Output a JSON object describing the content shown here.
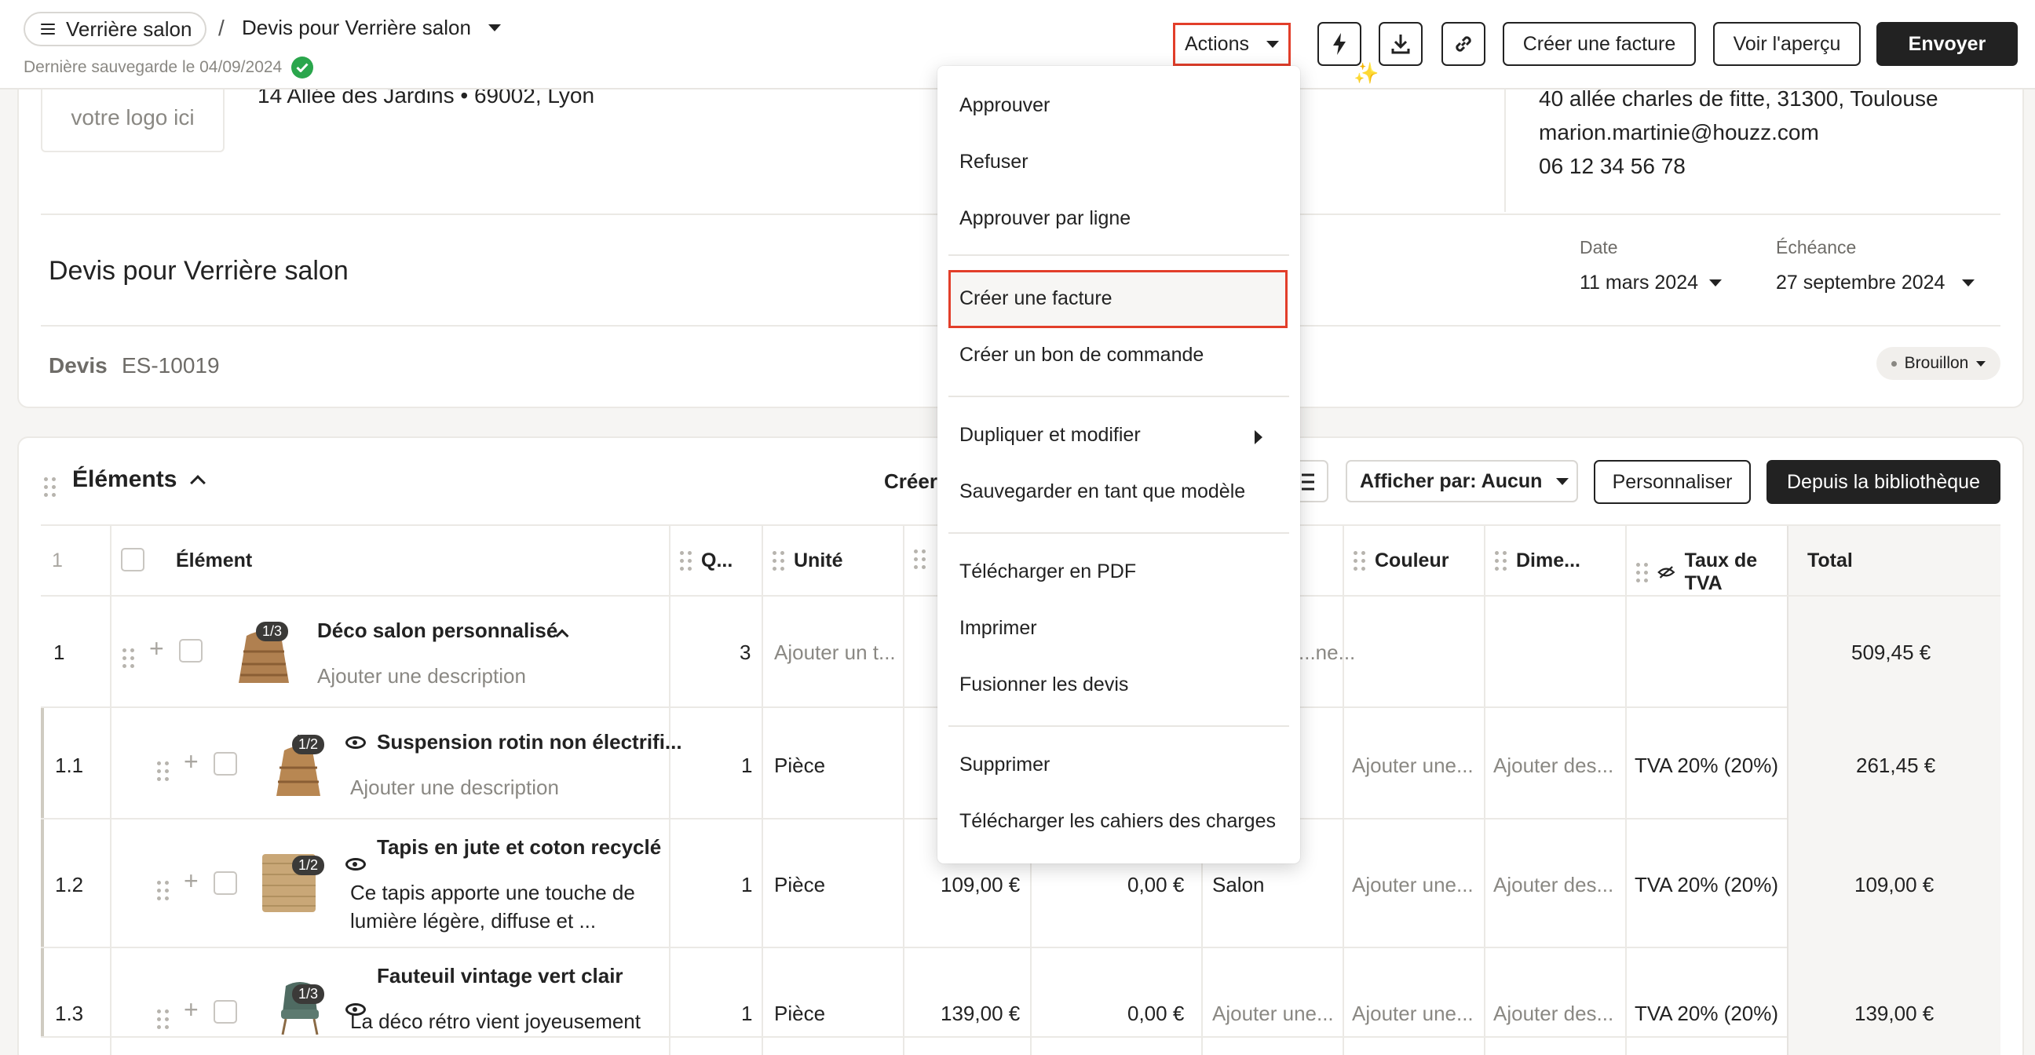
{
  "topbar": {
    "project": "Verrière salon",
    "separator": "/",
    "document_title": "Devis pour Verrière salon",
    "last_saved": "Dernière sauvegarde le 04/09/2024",
    "actions_label": "Actions",
    "create_invoice": "Créer une facture",
    "preview": "Voir l'aperçu",
    "send": "Envoyer"
  },
  "header": {
    "logo_placeholder": "votre logo ici",
    "company_address": "14 Allée des Jardins  •  69002, Lyon",
    "client": {
      "address": "40 allée charles de fitte, 31300, Toulouse",
      "email": "marion.martinie@houzz.com",
      "phone": "06 12 34 56 78"
    },
    "quote_title": "Devis pour Verrière salon",
    "date_label": "Date",
    "date_value": "11 mars 2024",
    "due_label": "Échéance",
    "due_value": "27 septembre 2024",
    "devis_label": "Devis",
    "devis_number": "ES-10019",
    "status": "Brouillon"
  },
  "elements": {
    "title": "Éléments",
    "create_label": "Créer",
    "display_by": "Afficher par: Aucun",
    "customize": "Personnaliser",
    "from_library": "Depuis la bibliothèque",
    "columns": {
      "index": "1",
      "element": "Élément",
      "qty": "Q...",
      "unit": "Unité",
      "color": "Couleur",
      "dimensions": "Dime...",
      "vat": "Taux de TVA",
      "total": "Total"
    },
    "rows": [
      {
        "num": "1",
        "badge": "1/3",
        "name": "Déco salon personnalisé",
        "desc": "Ajouter une description",
        "qty": "3",
        "unit": "Ajouter un t...",
        "extra": "...ne...",
        "total": "509,45 €"
      },
      {
        "num": "1.1",
        "badge": "1/2",
        "name": "Suspension rotin non électrifi...",
        "desc": "Ajouter une description",
        "qty": "1",
        "unit": "Pièce",
        "color": "Ajouter une...",
        "dimensions": "Ajouter des...",
        "vat": "TVA 20% (20%)",
        "total": "261,45 €"
      },
      {
        "num": "1.2",
        "badge": "1/2",
        "name": "Tapis en jute et coton recyclé",
        "desc_l1": "Ce tapis apporte une touche de",
        "desc_l2": "lumière légère, diffuse et ...",
        "qty": "1",
        "unit": "Pièce",
        "price": "109,00 €",
        "discount": "0,00 €",
        "room": "Salon",
        "color": "Ajouter une...",
        "dimensions": "Ajouter des...",
        "vat": "TVA 20% (20%)",
        "total": "109,00 €"
      },
      {
        "num": "1.3",
        "badge": "1/3",
        "name": "Fauteuil vintage vert clair",
        "desc": "La déco rétro vient joyeusement",
        "qty": "1",
        "unit": "Pièce",
        "price": "139,00 €",
        "discount": "0,00 €",
        "room": "Ajouter une...",
        "color": "Ajouter une...",
        "dimensions": "Ajouter des...",
        "vat": "TVA 20% (20%)",
        "total": "139,00 €"
      }
    ]
  },
  "menu": {
    "items": [
      "Approuver",
      "Refuser",
      "Approuver par ligne",
      "Créer une facture",
      "Créer un bon de commande",
      "Dupliquer et modifier",
      "Sauvegarder en tant que modèle",
      "Télécharger en PDF",
      "Imprimer",
      "Fusionner les devis",
      "Supprimer",
      "Télécharger les cahiers des charges"
    ]
  },
  "colors": {
    "highlight": "#e23e2a",
    "success": "#2aa64c",
    "primary_dark": "#222222"
  }
}
